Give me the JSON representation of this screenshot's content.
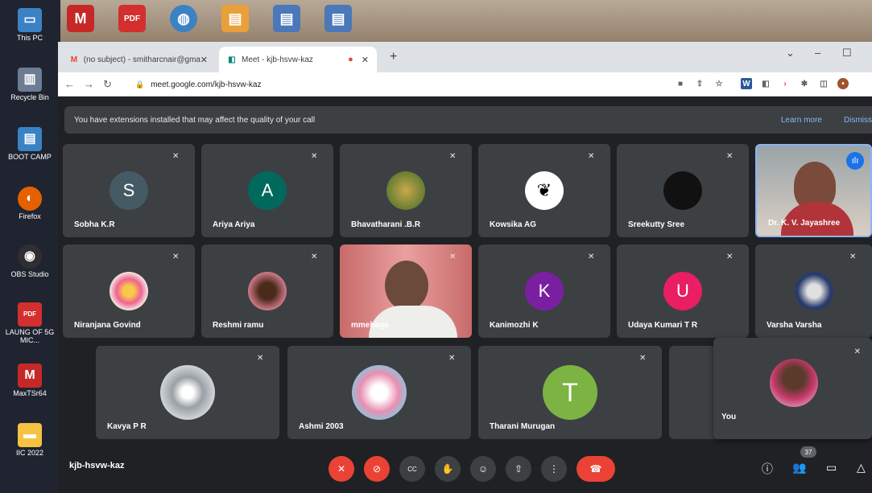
{
  "desktop": {
    "icons": [
      {
        "label": "This PC",
        "glyph": "🖥",
        "color": "#3b82c4"
      },
      {
        "label": "Recycle Bin",
        "glyph": "🗑",
        "color": "#6b7c93"
      },
      {
        "label": "BOOT CAMP",
        "glyph": "📄",
        "color": "#3b82c4"
      },
      {
        "label": "Firefox",
        "glyph": "🦊",
        "color": "#e66000"
      },
      {
        "label": "OBS Studio",
        "glyph": "◉",
        "color": "#302e31"
      },
      {
        "label": "LAUNG OF 5G MIC...",
        "glyph": "PDF",
        "color": "#d32f2f"
      },
      {
        "label": "MaxTSr64",
        "glyph": "M",
        "color": "#c62828"
      },
      {
        "label": "IIC 2022",
        "glyph": "📁",
        "color": "#f5c242"
      }
    ]
  },
  "browser": {
    "tabs": [
      {
        "title": "(no subject) - smitharcnair@gmai",
        "favicon": "M",
        "favicon_color": "#ea4335"
      },
      {
        "title": "Meet - kjb-hsvw-kaz",
        "favicon": "◧",
        "favicon_color": "#00897b",
        "recording": "●"
      }
    ],
    "new_tab": "+",
    "url": "meet.google.com/kjb-hsvw-kaz"
  },
  "meet": {
    "banner": {
      "text": "You have extensions installed that may affect the quality of your call",
      "learn_more": "Learn more",
      "dismiss": "Dismiss"
    },
    "row1": [
      {
        "name": "Sobha K.R",
        "initial": "S",
        "color": "#455a64"
      },
      {
        "name": "Ariya Ariya",
        "initial": "A",
        "color": "#00695c"
      },
      {
        "name": "Bhavatharani .B.R",
        "initial": "",
        "color": "#6d8a3a"
      },
      {
        "name": "Kowsika AG",
        "initial": "",
        "color": "#ffffff"
      },
      {
        "name": "Sreekutty Sree",
        "initial": "",
        "color": "#111111"
      },
      {
        "name": "Dr. K. V. Jayashree",
        "initial": "",
        "color": "#c9b8a8"
      }
    ],
    "row2": [
      {
        "name": "Niranjana Govind",
        "initial": "",
        "color": "#f3e6e0"
      },
      {
        "name": "Reshmi ramu",
        "initial": "",
        "color": "#b58b6a"
      },
      {
        "name": "mmehaga",
        "initial": "",
        "color": "#d98b8b"
      },
      {
        "name": "Kanimozhi K",
        "initial": "K",
        "color": "#7b1fa2"
      },
      {
        "name": "Udaya Kumari T R",
        "initial": "U",
        "color": "#e91e63"
      },
      {
        "name": "Varsha Varsha",
        "initial": "",
        "color": "#2a3b6b"
      }
    ],
    "row3": [
      {
        "name": "Kavya P R",
        "initial": "",
        "color": "#bfc3c8"
      },
      {
        "name": "Ashmi 2003",
        "initial": "",
        "color": "#e8d8e0"
      },
      {
        "name": "Tharani Murugan",
        "initial": "T",
        "color": "#7cb342"
      }
    ],
    "self": {
      "name": "You",
      "color": "#c06060"
    },
    "meeting_code": "kjb-hsvw-kaz",
    "participant_count": "37",
    "controls": {
      "captions": "CC"
    }
  }
}
